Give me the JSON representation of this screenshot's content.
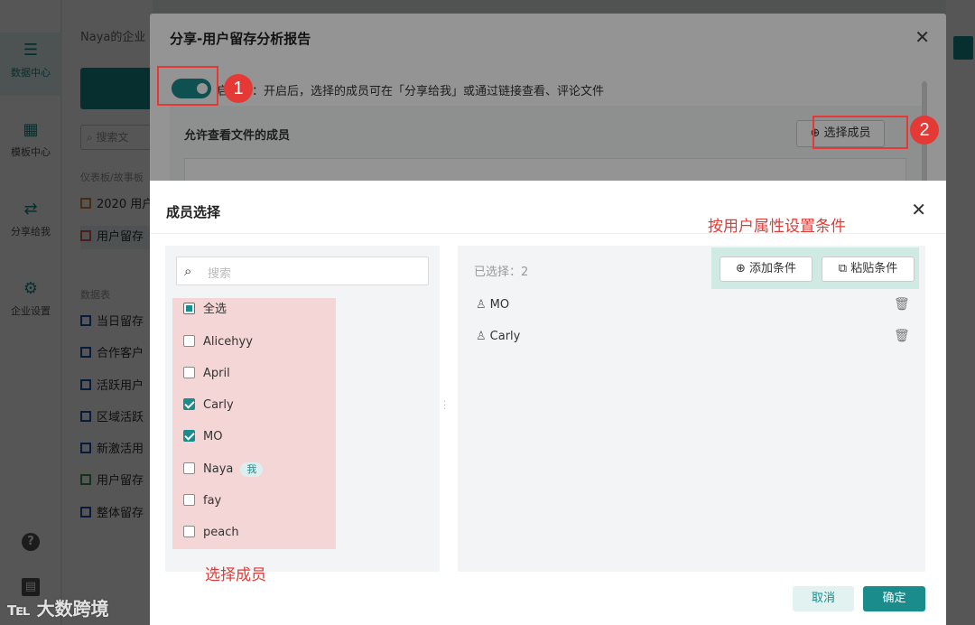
{
  "sidenav": {
    "items": [
      {
        "label": "数据中心",
        "icon": "data-center-icon"
      },
      {
        "label": "模板中心",
        "icon": "template-icon"
      },
      {
        "label": "分享给我",
        "icon": "share-icon"
      },
      {
        "label": "企业设置",
        "icon": "settings-icon"
      }
    ]
  },
  "panel": {
    "enterprise": "Naya的企业",
    "search_placeholder": "搜索文",
    "section_dashboard": "仪表板/故事板",
    "dash_items": [
      "2020 用户",
      "用户留存"
    ],
    "section_tables": "数据表",
    "table_items": [
      "当日留存",
      "合作客户",
      "活跃用户",
      "区域活跃",
      "新激活用",
      "用户留存",
      "整体留存"
    ]
  },
  "share_dialog": {
    "title": "分享-用户留存分析报告",
    "toggle_text": "启分享：开启后，选择的成员可在「分享给我」或通过链接查看、评论文件",
    "members_label": "允许查看文件的成员",
    "pick_button": "选择成员",
    "badge1": "1",
    "badge2": "2"
  },
  "member_dialog": {
    "title": "成员选择",
    "search_placeholder": "搜索",
    "select_all": "全选",
    "members": [
      {
        "name": "Alicehyy",
        "checked": false
      },
      {
        "name": "April",
        "checked": false
      },
      {
        "name": "Carly",
        "checked": true
      },
      {
        "name": "MO",
        "checked": true
      },
      {
        "name": "Naya",
        "checked": false,
        "tag": "我"
      },
      {
        "name": "fay",
        "checked": false
      },
      {
        "name": "peach",
        "checked": false
      }
    ],
    "selected_count": "已选择：2",
    "selected": [
      "MO",
      "Carly"
    ],
    "add_condition": "添加条件",
    "paste_condition": "粘贴条件",
    "cancel": "取消",
    "confirm": "确定"
  },
  "annotations": {
    "conditions_hint": "按用户属性设置条件",
    "select_members_hint": "选择成员"
  },
  "watermark": "大数跨境",
  "colors": {
    "accent": "#1a8c8c",
    "annotation": "#e53935"
  }
}
